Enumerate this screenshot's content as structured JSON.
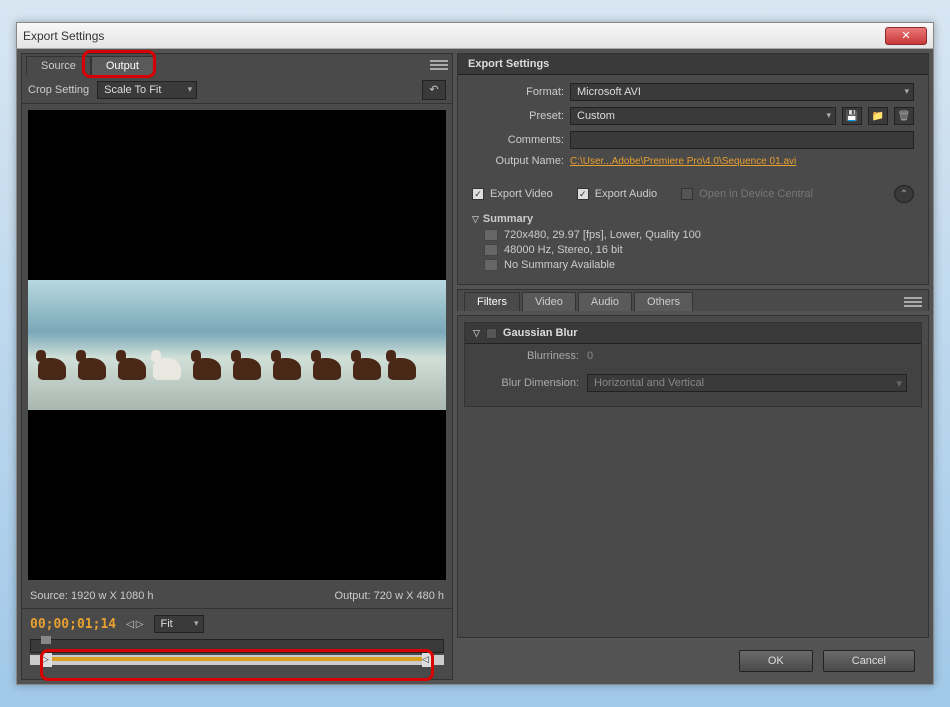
{
  "window": {
    "title": "Export Settings"
  },
  "leftPanel": {
    "tabs": {
      "source": "Source",
      "output": "Output"
    },
    "cropSettingLabel": "Crop Setting",
    "cropSettingValue": "Scale To Fit",
    "sourceDims": "Source: 1920 w X 1080 h",
    "outputDims": "Output: 720 w X 480 h",
    "timecode": "00;00;01;14",
    "zoom": "Fit"
  },
  "exportSettings": {
    "title": "Export Settings",
    "formatLabel": "Format:",
    "formatValue": "Microsoft AVI",
    "presetLabel": "Preset:",
    "presetValue": "Custom",
    "commentsLabel": "Comments:",
    "commentsValue": "",
    "outputNameLabel": "Output Name:",
    "outputNameValue": "C:\\User...Adobe\\Premiere Pro\\4.0\\Sequence 01.avi",
    "exportVideo": "Export Video",
    "exportAudio": "Export Audio",
    "openDevice": "Open in Device Central",
    "summaryTitle": "Summary",
    "summaryVideo": "720x480, 29.97 [fps], Lower, Quality 100",
    "summaryAudio": "48000 Hz, Stereo, 16 bit",
    "summaryOther": "No Summary Available"
  },
  "filterTabs": {
    "filters": "Filters",
    "video": "Video",
    "audio": "Audio",
    "others": "Others"
  },
  "filter": {
    "name": "Gaussian Blur",
    "blurrinessLabel": "Blurriness:",
    "blurrinessValue": "0",
    "blurDimLabel": "Blur Dimension:",
    "blurDimValue": "Horizontal and Vertical"
  },
  "buttons": {
    "ok": "OK",
    "cancel": "Cancel"
  }
}
